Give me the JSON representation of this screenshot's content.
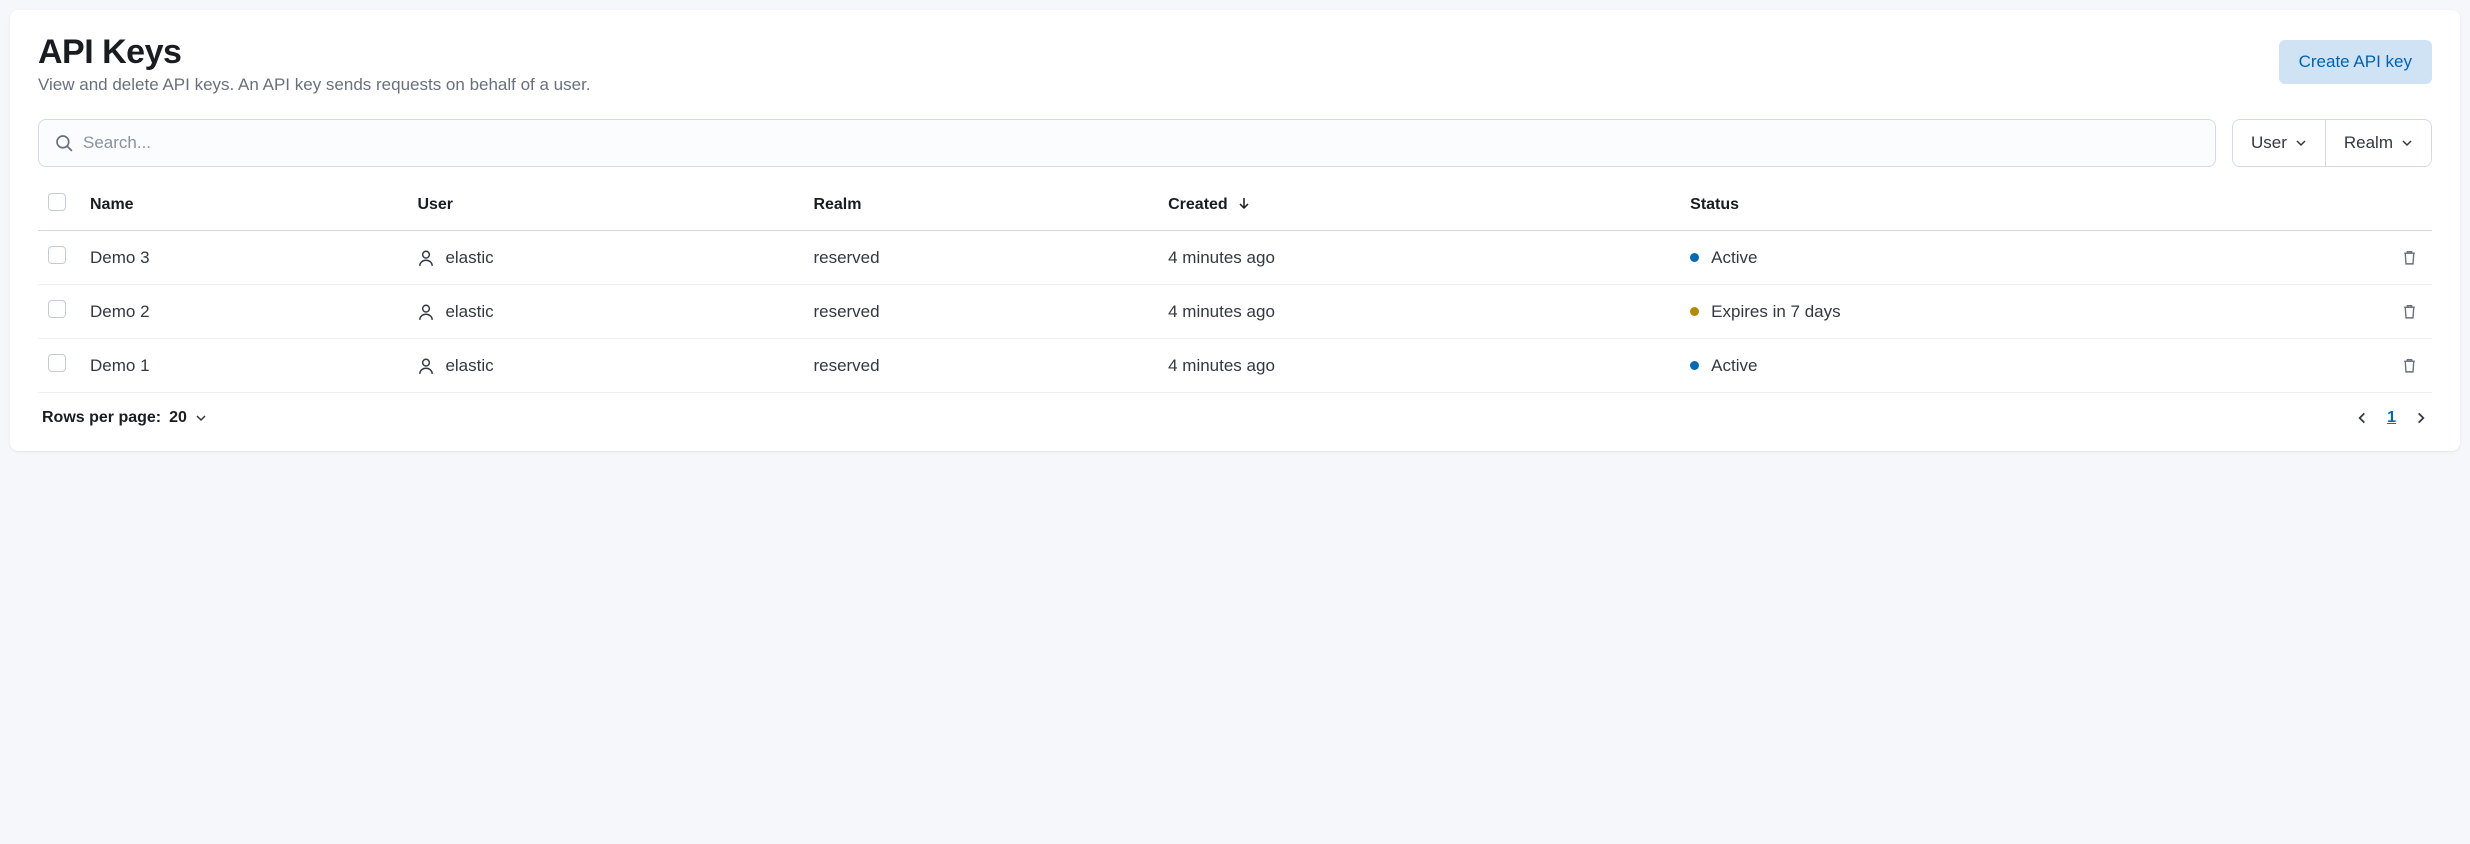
{
  "header": {
    "title": "API Keys",
    "subtitle": "View and delete API keys. An API key sends requests on behalf of a user.",
    "create_label": "Create API key"
  },
  "search": {
    "placeholder": "Search..."
  },
  "filters": {
    "user_label": "User",
    "realm_label": "Realm"
  },
  "columns": {
    "name": "Name",
    "user": "User",
    "realm": "Realm",
    "created": "Created",
    "status": "Status"
  },
  "rows": [
    {
      "name": "Demo 3",
      "user": "elastic",
      "realm": "reserved",
      "created": "4 minutes ago",
      "status_text": "Active",
      "status_color": "blue"
    },
    {
      "name": "Demo 2",
      "user": "elastic",
      "realm": "reserved",
      "created": "4 minutes ago",
      "status_text": "Expires in 7 days",
      "status_color": "gold"
    },
    {
      "name": "Demo 1",
      "user": "elastic",
      "realm": "reserved",
      "created": "4 minutes ago",
      "status_text": "Active",
      "status_color": "blue"
    }
  ],
  "pagination": {
    "rows_per_prefix": "Rows per page: ",
    "rows_per_value": "20",
    "current_page": "1"
  }
}
